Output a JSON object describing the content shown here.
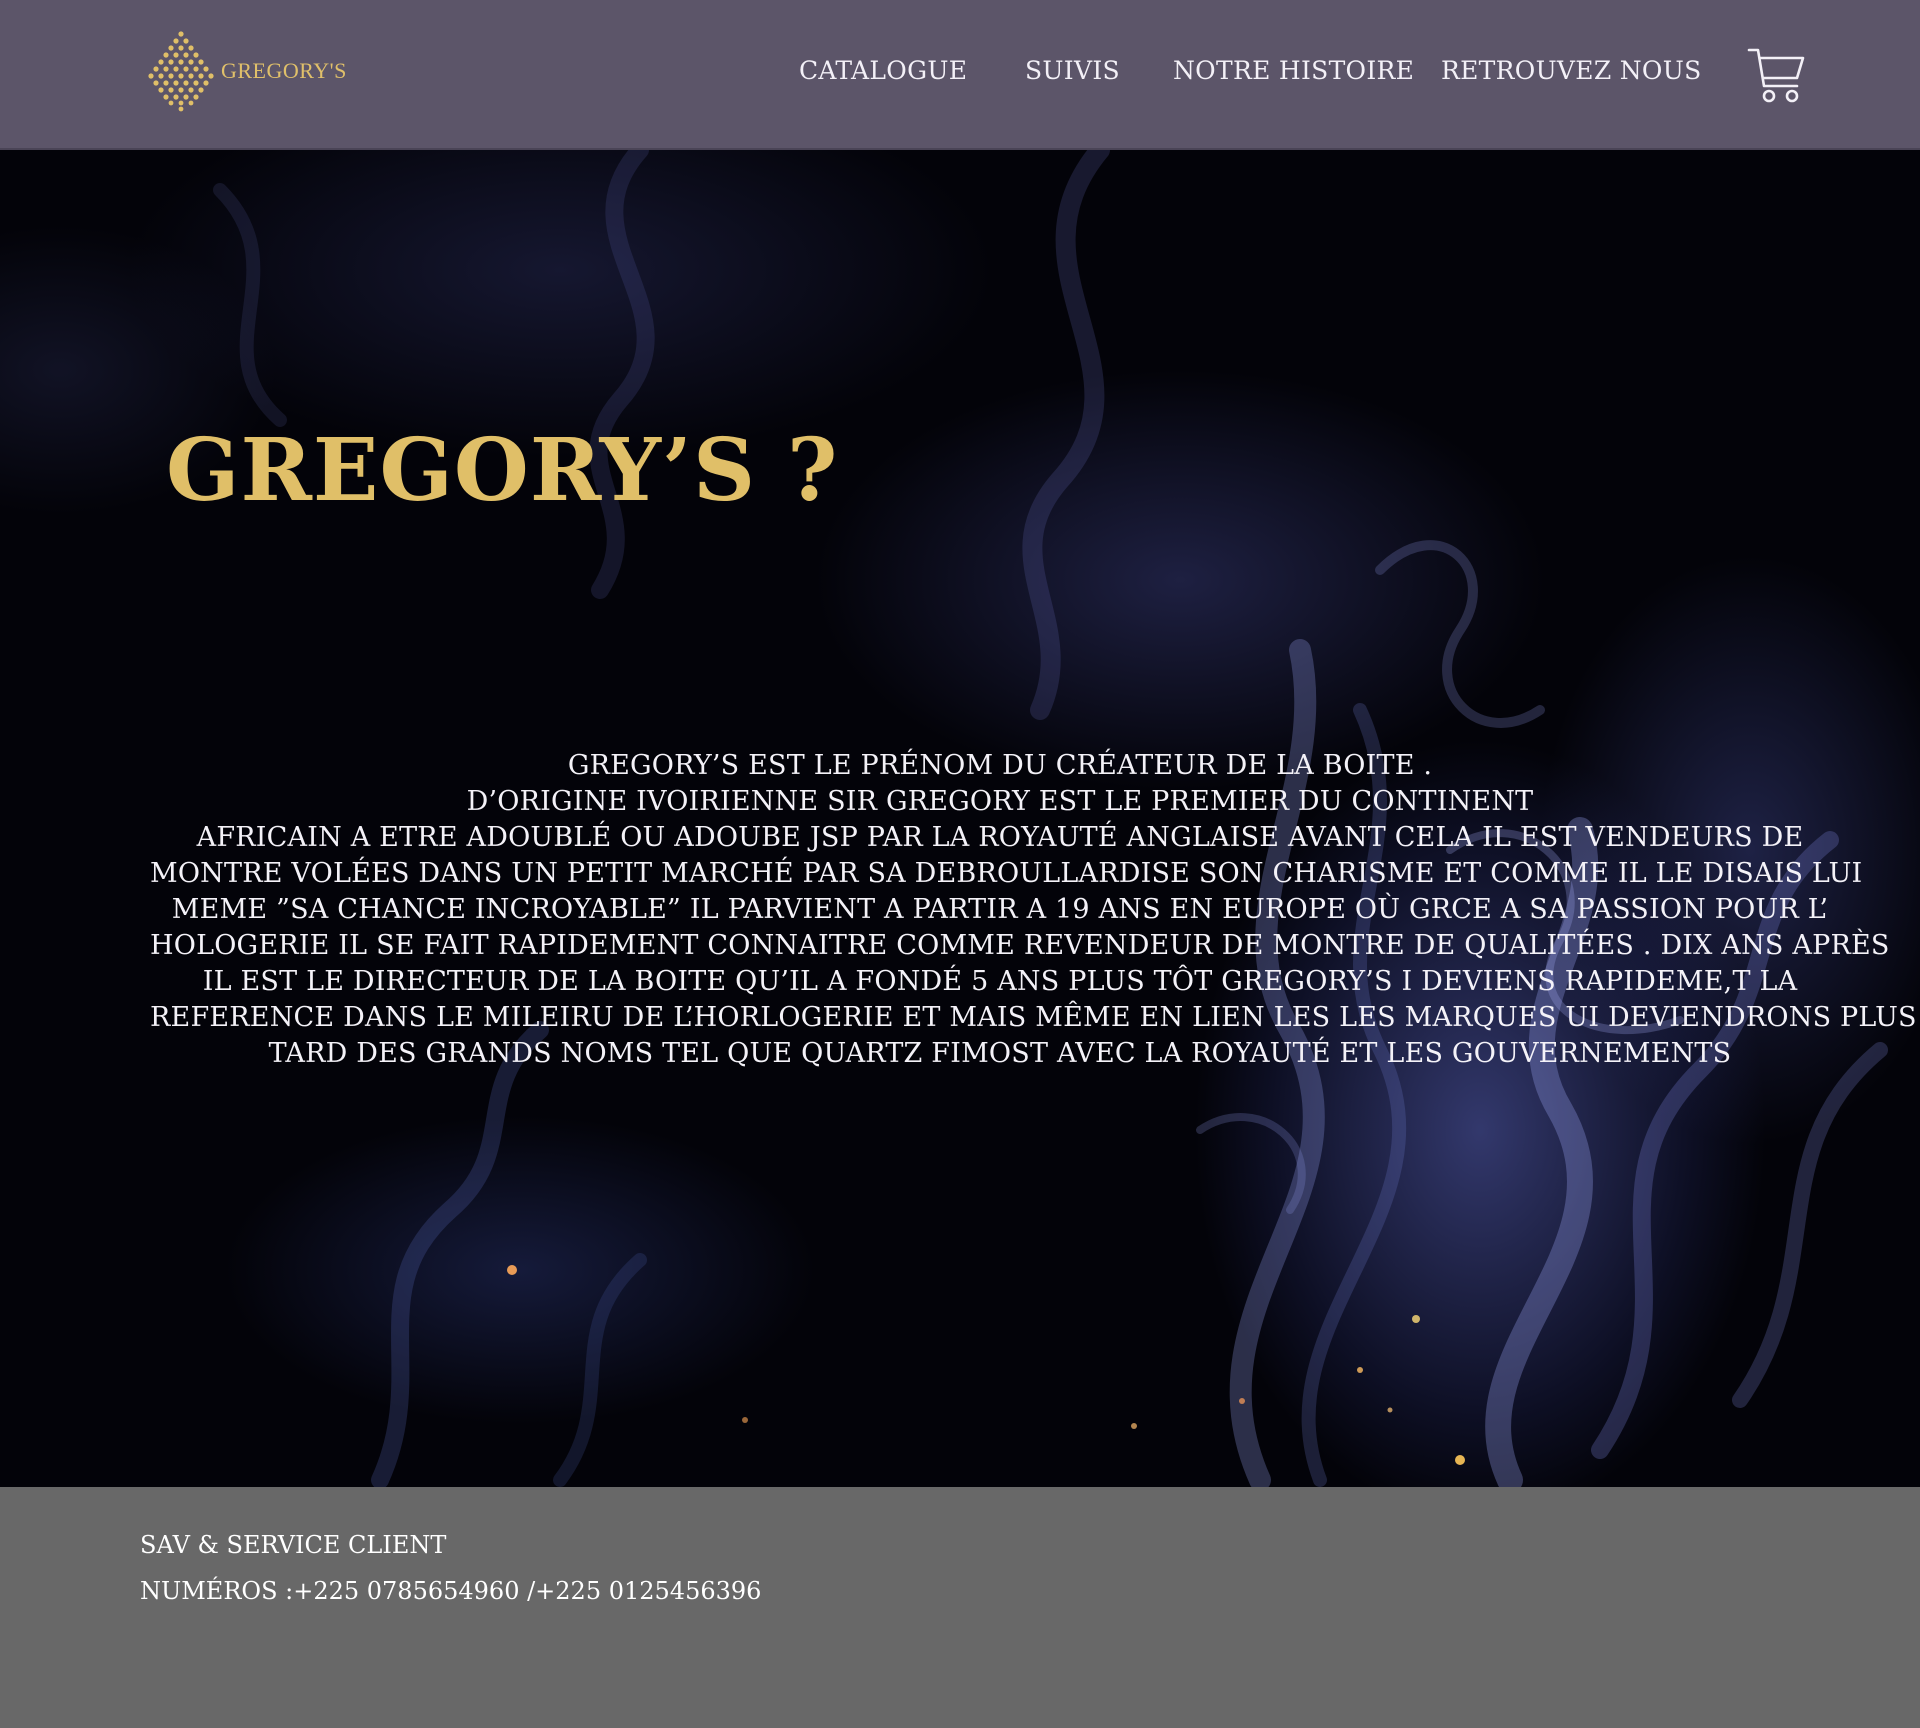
{
  "brand": {
    "name": "GREGORY'S",
    "logo_icon": "diamond-dots-logo-icon",
    "colors": {
      "gold": "#e0bf68",
      "header_bg": "#5c5569",
      "footer_bg": "#686868"
    }
  },
  "nav": {
    "items": [
      {
        "label": "CATALOGUE"
      },
      {
        "label": "SUIVIS"
      },
      {
        "label": "NOTRE HISTOIRE"
      },
      {
        "label": "RETROUVEZ NOUS"
      }
    ],
    "cart_icon": "shopping-cart-icon"
  },
  "hero": {
    "title": "GREGORY’S ?",
    "body_lines": [
      "GREGORY’S EST LE PRÉNOM DU CRÉATEUR DE LA BOITE .",
      "D’ORIGINE IVOIRIENNE SIR GREGORY EST LE PREMIER DU CONTINENT",
      "AFRICAIN A ETRE ADOUBLÉ OU ADOUBE JSP PAR LA ROYAUTÉ ANGLAISE AVANT CELA IL EST VENDEURS DE",
      "MONTRE VOLÉES DANS UN PETIT MARCHÉ PAR SA DEBROULLARDISE SON CHARISME ET COMME IL LE DISAIS LUI",
      "MEME ”SA CHANCE INCROYABLE” IL PARVIENT A PARTIR A 19 ANS EN EUROPE OÙ GRCE A SA PASSION POUR L’",
      "HOLOGERIE IL SE FAIT RAPIDEMENT CONNAITRE COMME REVENDEUR DE MONTRE DE QUALITÉES . DIX ANS APRÈS",
      "IL EST LE DIRECTEUR DE LA BOITE QU’IL A FONDÉ 5 ANS PLUS TÔT GREGORY’S I DEVIENS RAPIDEME,T LA",
      "REFERENCE DANS LE MILEIRU DE L’HORLOGERIE ET MAIS MÊME EN LIEN LES LES MARQUES UI DEVIENDRONS PLUS",
      "TARD DES GRANDS NOMS TEL QUE QUARTZ FIMOST  AVEC LA ROYAUTÉ  ET LES GOUVERNEMENTS"
    ]
  },
  "footer": {
    "title": "SAV & SERVICE CLIENT",
    "phones": "NUMÉROS :+225 0785654960 /+225 0125456396"
  }
}
